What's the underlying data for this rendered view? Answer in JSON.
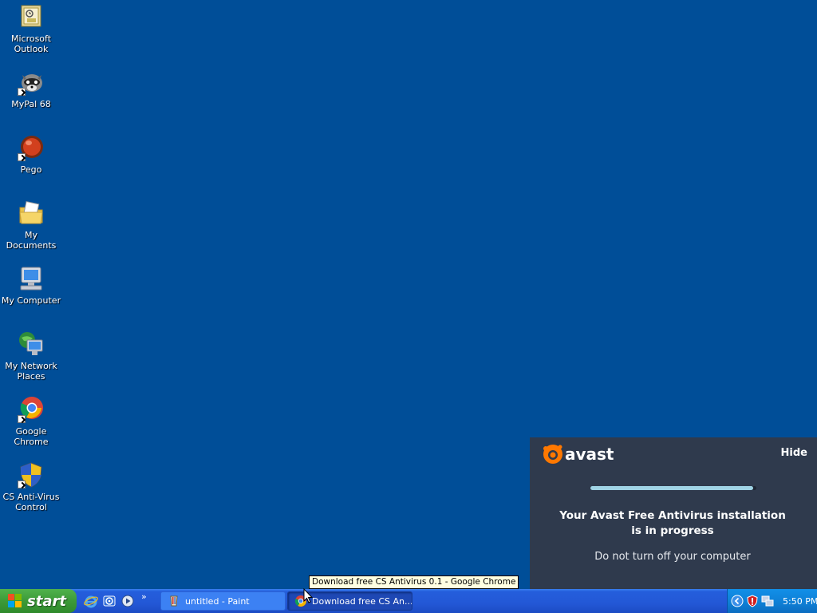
{
  "desktop": {
    "icons": [
      {
        "label": "Microsoft\nOutlook",
        "icon": "outlook-icon"
      },
      {
        "label": "MyPal 68",
        "icon": "mypal-icon"
      },
      {
        "label": "Pego",
        "icon": "pego-icon"
      },
      {
        "label": "My Documents",
        "icon": "folder-documents-icon"
      },
      {
        "label": "My Computer",
        "icon": "computer-icon"
      },
      {
        "label": "My Network\nPlaces",
        "icon": "network-icon"
      },
      {
        "label": "Google Chrome",
        "icon": "chrome-icon"
      },
      {
        "label": "CS Anti-Virus\nControl",
        "icon": "shield-icon"
      }
    ]
  },
  "avast": {
    "logo_text": "avast",
    "hide_label": "Hide",
    "progress": 0.98,
    "title_line1": "Your Avast Free Antivirus installation",
    "title_line2": "is in progress",
    "subtitle": "Do not turn off your computer",
    "brand_color": "#FF7800"
  },
  "tooltip": {
    "text": "Download free CS Antivirus 0.1 - Google Chrome"
  },
  "taskbar": {
    "start_label": "start",
    "quicklaunch": [
      "internet-explorer-icon",
      "outlook-express-icon",
      "media-player-icon"
    ],
    "more_label": "»",
    "tasks": [
      {
        "label": "untitled - Paint",
        "icon": "paint-icon",
        "active": false
      },
      {
        "label": "Download free CS An...",
        "icon": "chrome-icon",
        "active": true
      }
    ],
    "tray_icons": [
      "tray-expand-icon",
      "security-shield-icon",
      "network-tray-icon"
    ],
    "clock": "5:50 PM"
  }
}
